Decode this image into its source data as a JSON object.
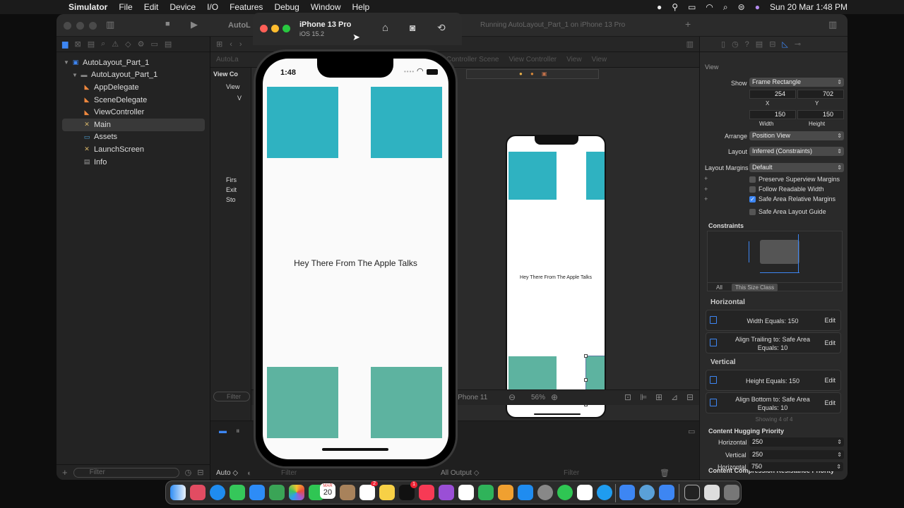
{
  "menubar": {
    "app": "Simulator",
    "items": [
      "File",
      "Edit",
      "Device",
      "I/O",
      "Features",
      "Debug",
      "Window",
      "Help"
    ],
    "clock": "Sun 20 Mar  1:48 PM"
  },
  "xcode": {
    "project_tab": "AutoL",
    "status": "Running AutoLayout_Part_1 on iPhone 13 Pro",
    "navigator": {
      "items": [
        {
          "label": "AutoLayout_Part_1",
          "icon": "blueprint-icon",
          "level": 0
        },
        {
          "label": "AutoLayout_Part_1",
          "icon": "folder-icon",
          "level": 1
        },
        {
          "label": "AppDelegate",
          "icon": "swift-icon",
          "level": 2
        },
        {
          "label": "SceneDelegate",
          "icon": "swift-icon",
          "level": 2
        },
        {
          "label": "ViewController",
          "icon": "swift-icon",
          "level": 2
        },
        {
          "label": "Main",
          "icon": "storyboard-icon",
          "level": 2,
          "selected": true
        },
        {
          "label": "Assets",
          "icon": "assets-icon",
          "level": 2
        },
        {
          "label": "LaunchScreen",
          "icon": "storyboard-icon",
          "level": 2
        },
        {
          "label": "Info",
          "icon": "plist-icon",
          "level": 2
        }
      ],
      "filter_placeholder": "Filter"
    },
    "jumpbar": {
      "items": [
        "AutoLa",
        "View Controller Scene",
        "View Controller",
        "View",
        "View"
      ]
    },
    "outline": {
      "items": [
        "View Co",
        "View",
        "V",
        "Firs",
        "Exit",
        "Sto"
      ],
      "filter_placeholder": "Filter"
    },
    "canvas": {
      "label": "Hey There From The Apple Talks",
      "device_label": "iPhone 11",
      "zoom": "56%",
      "colors": {
        "top": "#2fb2c1",
        "bottom": "#5db3a0"
      }
    },
    "debug": {
      "auto": "Auto ◇",
      "filter": "Filter",
      "output": "All Output ◇",
      "filter2": "Filter"
    },
    "inspector": {
      "title": "View",
      "show_label": "Show",
      "show_value": "Frame Rectangle",
      "x": "254",
      "y": "702",
      "x_label": "X",
      "y_label": "Y",
      "width": "150",
      "height": "150",
      "width_label": "Width",
      "height_label": "Height",
      "arrange_label": "Arrange",
      "arrange_value": "Position View",
      "layout_label": "Layout",
      "layout_value": "Inferred (Constraints)",
      "margins_label": "Layout Margins",
      "margins_value": "Default",
      "checks": [
        {
          "label": "Preserve Superview Margins",
          "checked": false
        },
        {
          "label": "Follow Readable Width",
          "checked": false
        },
        {
          "label": "Safe Area Relative Margins",
          "checked": true
        },
        {
          "label": "Safe Area Layout Guide",
          "checked": false
        }
      ],
      "constraints_title": "Constraints",
      "seg_all": "All",
      "seg_size": "This Size Class",
      "horizontal": "Horizontal",
      "vertical": "Vertical",
      "h_constraints": [
        {
          "text": "Width Equals:  150",
          "edit": "Edit"
        },
        {
          "text": "Align Trailing to:  Safe Area\nEquals:  10",
          "edit": "Edit"
        }
      ],
      "v_constraints": [
        {
          "text": "Height Equals:  150",
          "edit": "Edit"
        },
        {
          "text": "Align Bottom to:  Safe Area\nEquals:  10",
          "edit": "Edit"
        }
      ],
      "showing": "Showing 4 of 4",
      "hugging_title": "Content Hugging Priority",
      "hug_h_label": "Horizontal",
      "hug_h": "250",
      "hug_v_label": "Vertical",
      "hug_v": "250",
      "compression_title": "Content Compression Resistance Priority",
      "comp_h_label": "Horizontal",
      "comp_h": "750"
    }
  },
  "simulator": {
    "device": "iPhone 13 Pro",
    "os": "iOS 15.2",
    "time": "1:48",
    "label": "Hey There From The Apple Talks",
    "colors": {
      "top": "#2fb2c1",
      "bottom": "#5db3a0"
    }
  },
  "dock": {
    "calendar_month": "MAR",
    "calendar_day": "20",
    "mail_badge": "2",
    "tv_badge": "1"
  }
}
